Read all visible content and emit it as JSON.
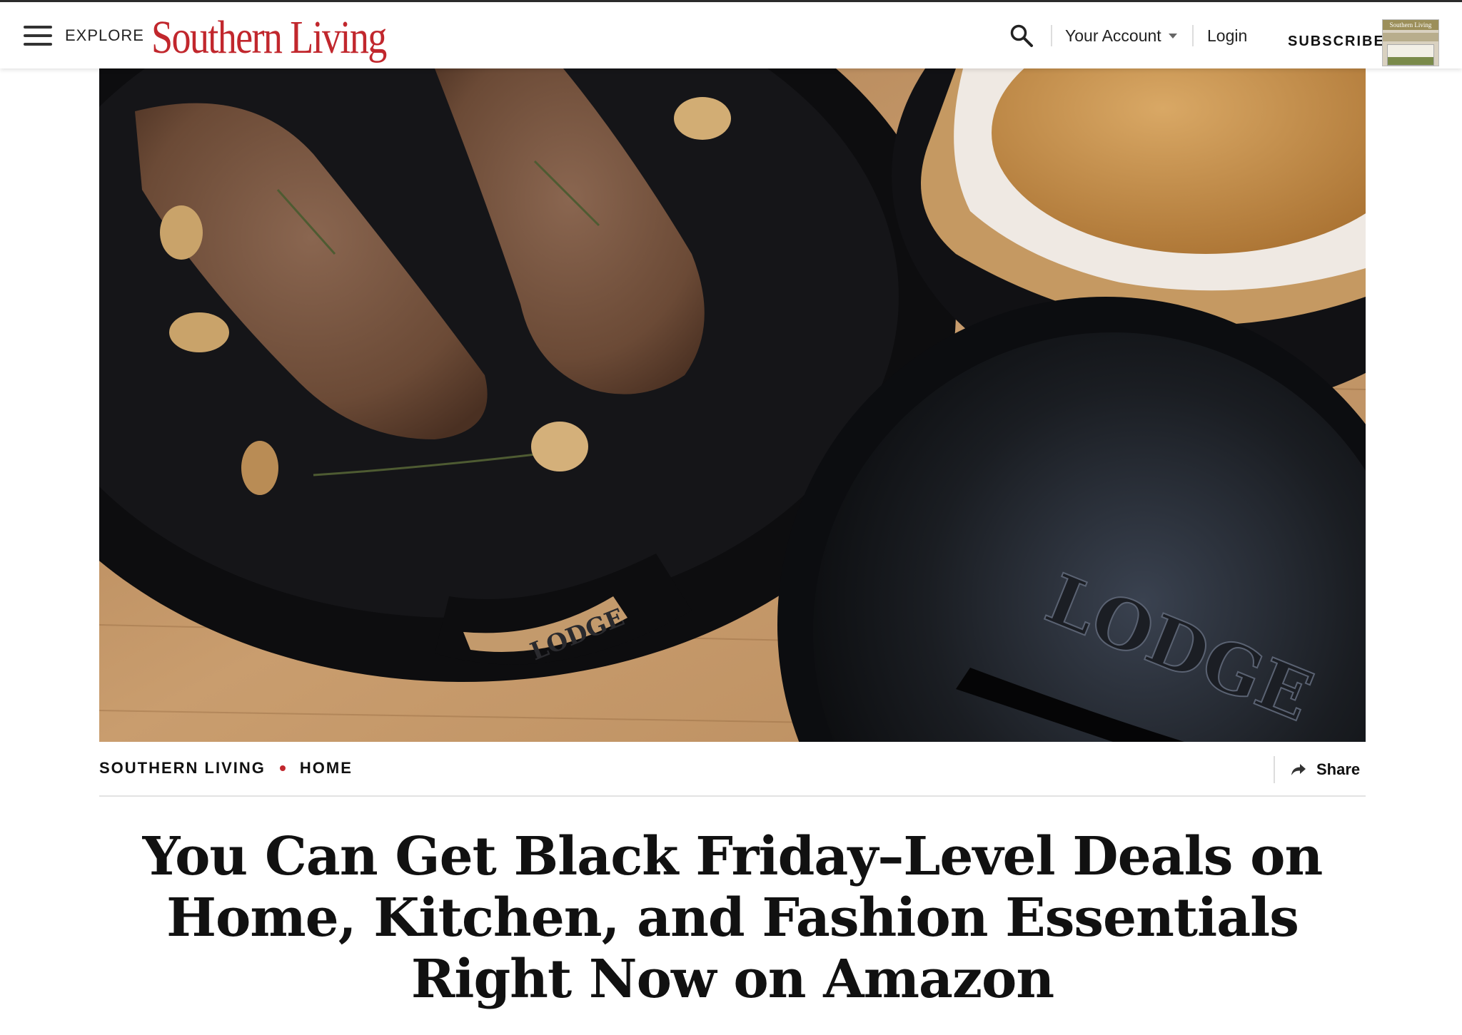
{
  "header": {
    "explore_label": "EXPLORE",
    "logo_text": "Southern Living",
    "account_label": "Your Account",
    "login_label": "Login",
    "subscribe_label": "SUBSCRIBE",
    "magazine_masthead": "Southern Living"
  },
  "icons": {
    "menu": "hamburger-icon",
    "search": "search-icon",
    "dropdown": "caret-down-icon",
    "share": "share-arrow-icon"
  },
  "hero": {
    "lid_brand": "LODGE",
    "handle_brand": "LODGE"
  },
  "breadcrumb": {
    "items": [
      "SOUTHERN LIVING",
      "HOME"
    ]
  },
  "share_label": "Share",
  "article": {
    "title": "You Can Get Black Friday–Level Deals on Home, Kitchen, and Fashion Essentials Right Now on Amazon"
  },
  "colors": {
    "brand_red": "#c1272d",
    "text": "#111111",
    "rule": "#e3e3e3"
  }
}
